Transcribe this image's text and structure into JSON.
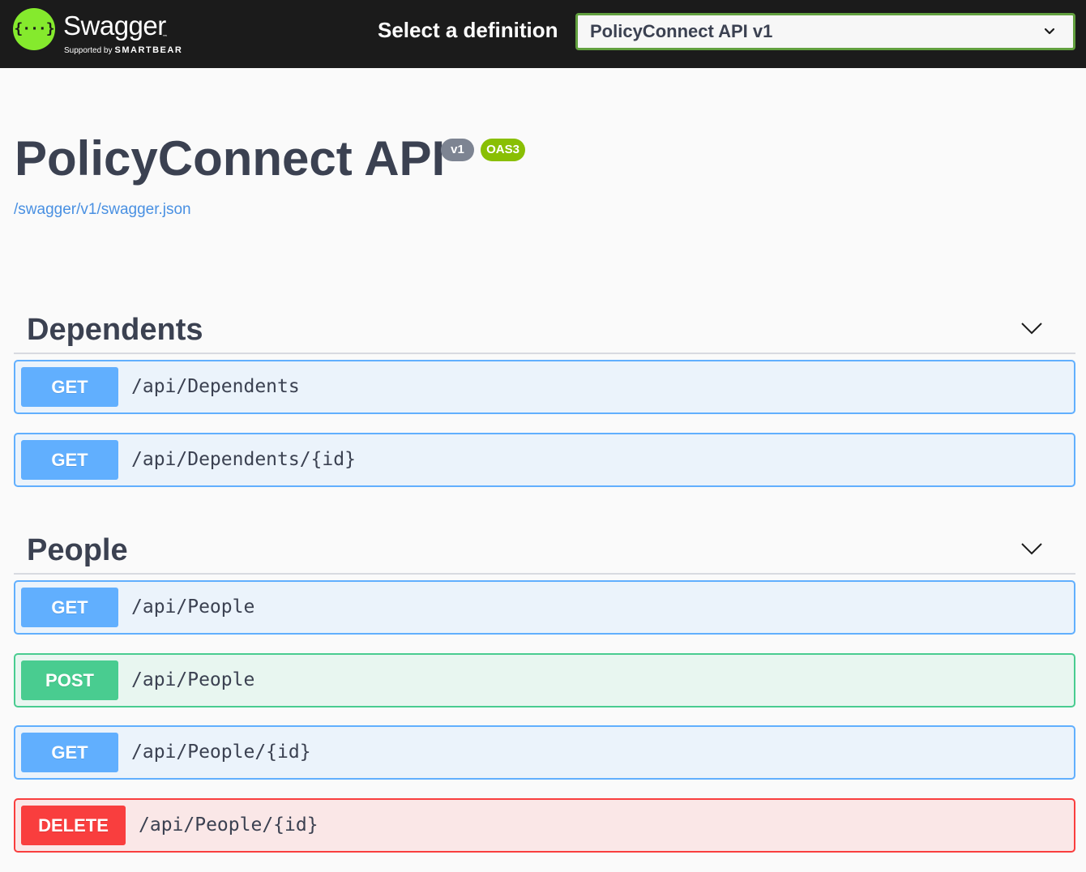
{
  "topbar": {
    "logo_glyph": "{···}",
    "logo_title": "Swagger",
    "logo_tm": "™",
    "logo_supported": "Supported by",
    "logo_brand": "SMARTBEAR",
    "select_label": "Select a definition",
    "selected_definition": "PolicyConnect API v1"
  },
  "info": {
    "title": "PolicyConnect API",
    "version_badge": "v1",
    "oas_badge": "OAS3",
    "spec_link": "/swagger/v1/swagger.json"
  },
  "tags": [
    {
      "name": "Dependents",
      "operations": [
        {
          "method": "GET",
          "path": "/api/Dependents"
        },
        {
          "method": "GET",
          "path": "/api/Dependents/{id}"
        }
      ]
    },
    {
      "name": "People",
      "operations": [
        {
          "method": "GET",
          "path": "/api/People"
        },
        {
          "method": "POST",
          "path": "/api/People"
        },
        {
          "method": "GET",
          "path": "/api/People/{id}"
        },
        {
          "method": "DELETE",
          "path": "/api/People/{id}"
        }
      ]
    }
  ],
  "colors": {
    "topbar_bg": "#1b1b1b",
    "logo_green": "#85ea2d",
    "select_border": "#62a03f",
    "get": "#61affe",
    "post": "#49cc90",
    "delete": "#f93e3e",
    "text": "#3b4151",
    "link": "#4990e2"
  },
  "icons": {
    "select_chevron": "chevron-down-icon",
    "tag_chevron": "chevron-down-icon",
    "logo": "swagger-logo-icon"
  }
}
